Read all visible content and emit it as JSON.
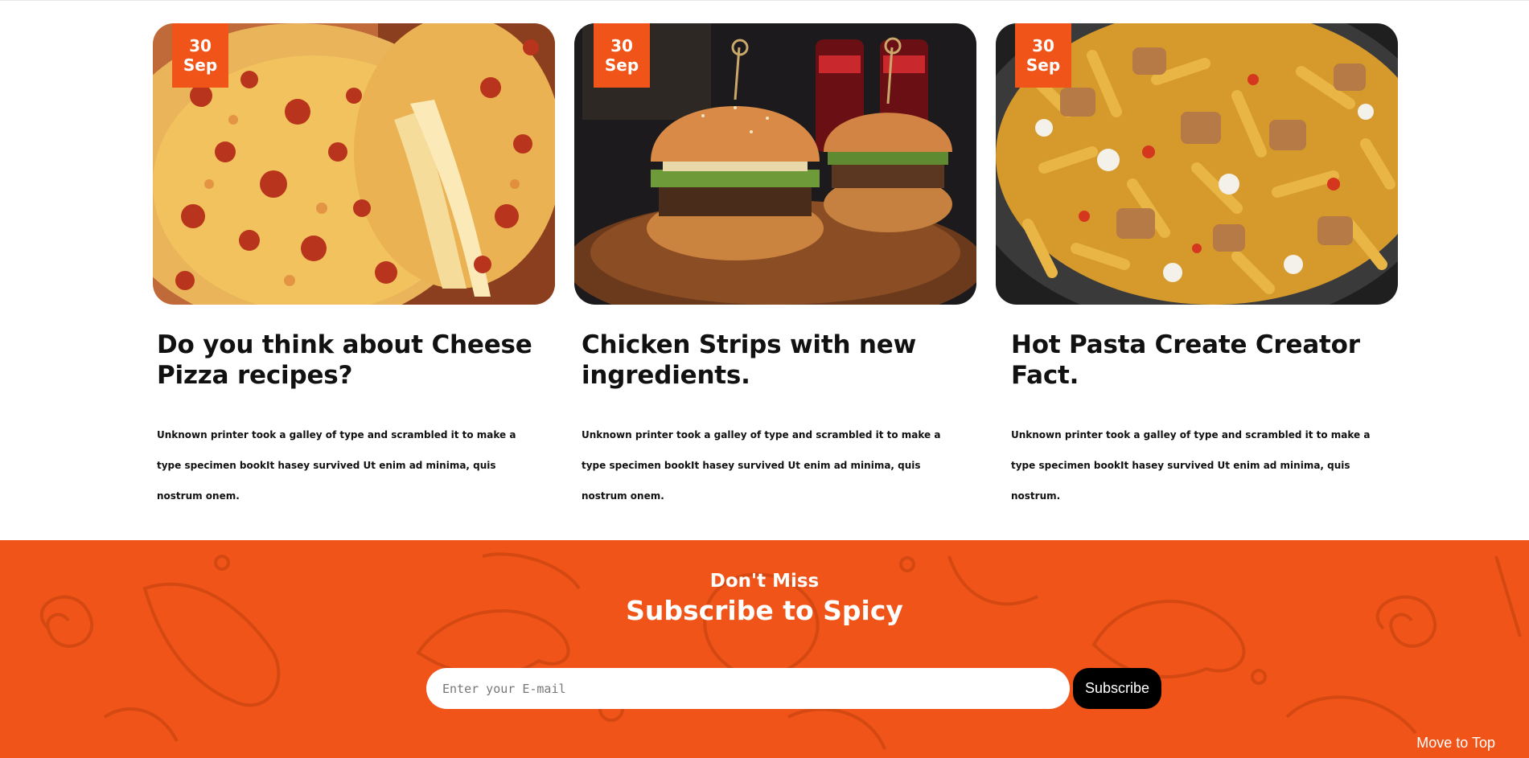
{
  "posts": [
    {
      "day": "30",
      "month": "Sep",
      "title": "Do you think about Cheese Pizza recipes?",
      "excerpt": "Unknown printer took a galley of type and scrambled it to make a type specimen bookIt hasey survived Ut enim ad minima, quis nostrum onem."
    },
    {
      "day": "30",
      "month": "Sep",
      "title": "Chicken Strips with new ingredients.",
      "excerpt": "Unknown printer took a galley of type and scrambled it to make a type specimen bookIt hasey survived Ut enim ad minima, quis nostrum onem."
    },
    {
      "day": "30",
      "month": "Sep",
      "title": "Hot Pasta Create Creator Fact.",
      "excerpt": "Unknown printer took a galley of type and scrambled it to make a type specimen bookIt hasey survived Ut enim ad minima, quis nostrum."
    }
  ],
  "subscribe": {
    "kicker": "Don't Miss",
    "heading": "Subscribe to Spicy",
    "email_placeholder": "Enter your E-mail",
    "button_label": "Subscribe"
  },
  "move_to_top": "Move to Top",
  "colors": {
    "accent": "#f05418",
    "button": "#000000"
  }
}
